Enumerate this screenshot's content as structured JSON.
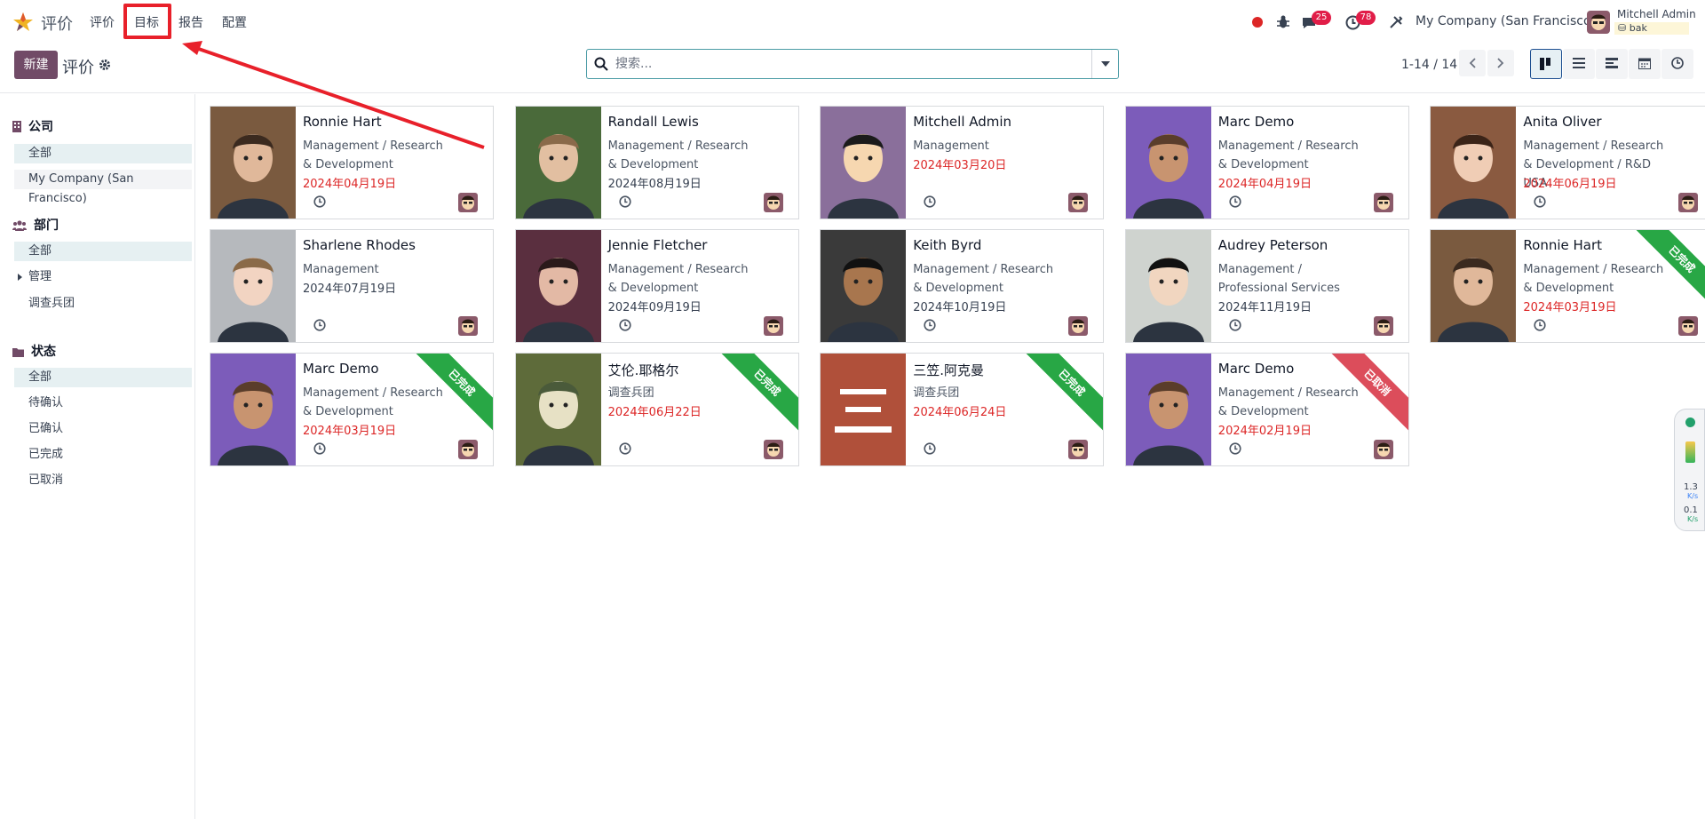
{
  "app": {
    "title": "评价"
  },
  "menu": [
    {
      "label": "评价"
    },
    {
      "label": "目标"
    },
    {
      "label": "报告"
    },
    {
      "label": "配置"
    }
  ],
  "systray": {
    "messages_count": "25",
    "activities_count": "78",
    "company": "My Company (San Francisco)",
    "user_name": "Mitchell Admin",
    "database": "bak"
  },
  "control": {
    "new_label": "新建",
    "breadcrumb": "评价",
    "search_placeholder": "搜索...",
    "pager": "1-14 / 14"
  },
  "sidebar": {
    "company": {
      "title": "公司",
      "items": [
        "全部",
        "My Company (San Francisco)"
      ]
    },
    "department": {
      "title": "部门",
      "items": [
        "全部",
        "管理",
        "调查兵团"
      ]
    },
    "state": {
      "title": "状态",
      "items": [
        "全部",
        "待确认",
        "已确认",
        "已完成",
        "已取消"
      ]
    }
  },
  "cards": [
    {
      "name": "Ronnie Hart",
      "dept": "Management / Research & Development",
      "date": "2024年04月19日",
      "date_color": "red"
    },
    {
      "name": "Randall Lewis",
      "dept": "Management / Research & Development",
      "date": "2024年08月19日",
      "date_color": "dark"
    },
    {
      "name": "Mitchell Admin",
      "dept": "Management",
      "date": "2024年03月20日",
      "date_color": "red"
    },
    {
      "name": "Marc Demo",
      "dept": "Management / Research & Development",
      "date": "2024年04月19日",
      "date_color": "red"
    },
    {
      "name": "Anita Oliver",
      "dept": "Management / Research & Development / R&D USA",
      "date": "2024年06月19日",
      "date_color": "red"
    },
    {
      "name": "Sharlene Rhodes",
      "dept": "Management",
      "date": "2024年07月19日",
      "date_color": "dark"
    },
    {
      "name": "Jennie Fletcher",
      "dept": "Management / Research & Development",
      "date": "2024年09月19日",
      "date_color": "dark"
    },
    {
      "name": "Keith Byrd",
      "dept": "Management / Research & Development",
      "date": "2024年10月19日",
      "date_color": "dark"
    },
    {
      "name": "Audrey Peterson",
      "dept": "Management / Professional Services",
      "date": "2024年11月19日",
      "date_color": "dark"
    },
    {
      "name": "Ronnie Hart",
      "dept": "Management / Research & Development",
      "date": "2024年03月19日",
      "date_color": "red",
      "ribbon": "已完成",
      "ribbon_color": "green"
    },
    {
      "name": "Marc Demo",
      "dept": "Management / Research & Development",
      "date": "2024年03月19日",
      "date_color": "red",
      "ribbon": "已完成",
      "ribbon_color": "green"
    },
    {
      "name": "艾伦.耶格尔",
      "dept": "调查兵团",
      "date": "2024年06月22日",
      "date_color": "red",
      "ribbon": "已完成",
      "ribbon_color": "green"
    },
    {
      "name": "三笠.阿克曼",
      "dept": "调查兵团",
      "date": "2024年06月24日",
      "date_color": "red",
      "ribbon": "已完成",
      "ribbon_color": "green",
      "initial": "三"
    },
    {
      "name": "Marc Demo",
      "dept": "Management / Research & Development",
      "date": "2024年02月19日",
      "date_color": "red",
      "ribbon": "已取消",
      "ribbon_color": "red"
    }
  ],
  "widget": {
    "up": "1.3",
    "down": "0.1",
    "unit": "K/s"
  }
}
